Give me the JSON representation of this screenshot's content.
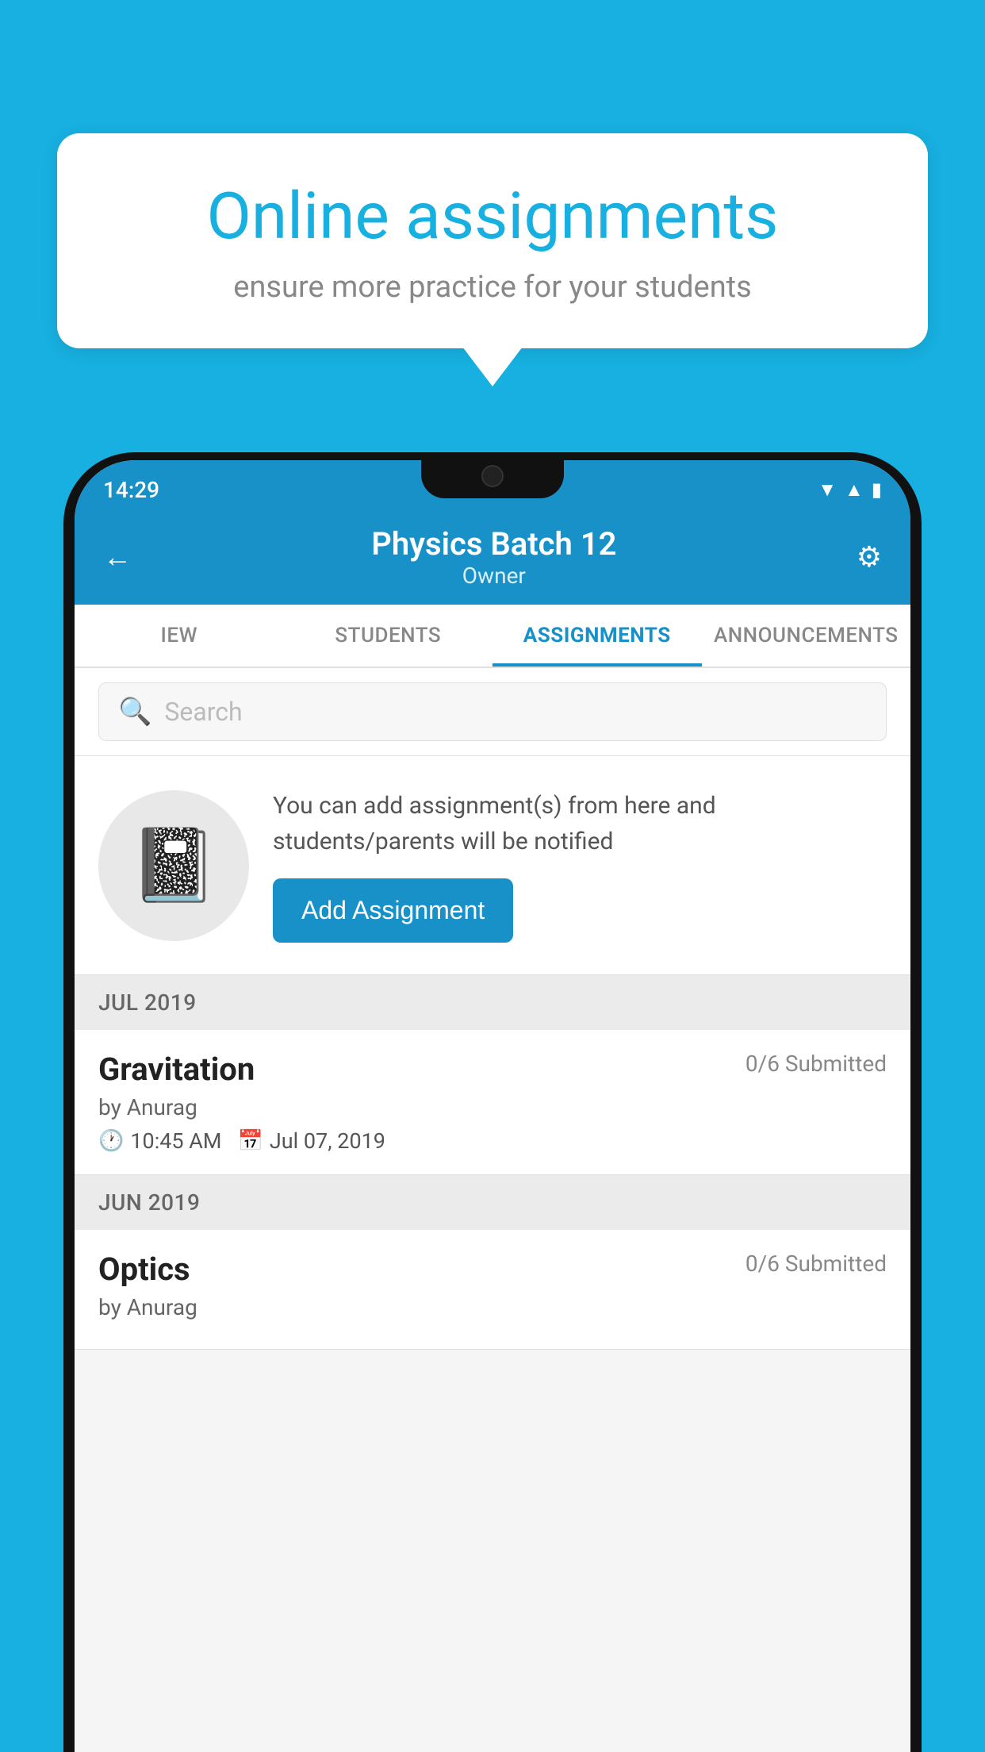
{
  "background_color": "#17b0e0",
  "speech_bubble": {
    "title": "Online assignments",
    "subtitle": "ensure more practice for your students"
  },
  "status_bar": {
    "time": "14:29",
    "icons": [
      "wifi",
      "signal",
      "battery"
    ]
  },
  "header": {
    "title": "Physics Batch 12",
    "subtitle": "Owner",
    "back_label": "←",
    "settings_label": "⚙"
  },
  "tabs": [
    {
      "label": "IEW",
      "active": false
    },
    {
      "label": "STUDENTS",
      "active": false
    },
    {
      "label": "ASSIGNMENTS",
      "active": true
    },
    {
      "label": "ANNOUNCEMENTS",
      "active": false
    }
  ],
  "search": {
    "placeholder": "Search"
  },
  "promo": {
    "description": "You can add assignment(s) from here and students/parents will be notified",
    "button_label": "Add Assignment"
  },
  "sections": [
    {
      "label": "JUL 2019",
      "assignments": [
        {
          "name": "Gravitation",
          "submitted": "0/6 Submitted",
          "by": "by Anurag",
          "time": "10:45 AM",
          "date": "Jul 07, 2019"
        }
      ]
    },
    {
      "label": "JUN 2019",
      "assignments": [
        {
          "name": "Optics",
          "submitted": "0/6 Submitted",
          "by": "by Anurag",
          "time": "",
          "date": ""
        }
      ]
    }
  ]
}
